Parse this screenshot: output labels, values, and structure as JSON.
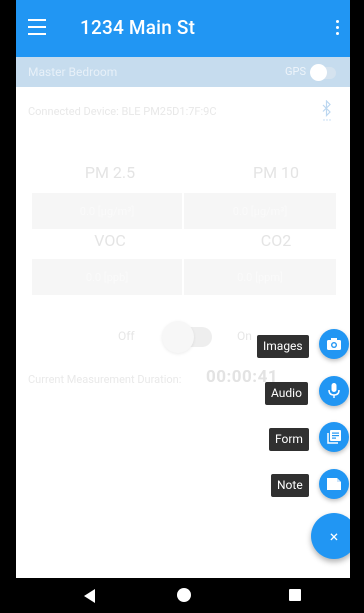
{
  "appbar": {
    "title": "1234 Main St"
  },
  "subbar": {
    "room": "Master Bedroom",
    "gps_label": "GPS"
  },
  "device": {
    "label": "Connected Device: BLE PM25D1:7F:9C"
  },
  "metrics": {
    "pm25": {
      "label": "PM 2.5",
      "value": "0.0 [µg/m³]"
    },
    "pm10": {
      "label": "PM 10",
      "value": "0.0 [µg/m³]"
    },
    "voc": {
      "label": "VOC",
      "value": "0.0 [ppb]"
    },
    "co2": {
      "label": "CO2",
      "value": "0.0 [ppm]"
    }
  },
  "toggle": {
    "off_label": "Off",
    "on_label": "On"
  },
  "duration": {
    "label": "Current Measurement Duration:",
    "value": "00:00:41"
  },
  "fab_menu": {
    "images_label": "Images",
    "audio_label": "Audio",
    "form_label": "Form",
    "note_label": "Note",
    "close_glyph": "×"
  },
  "colors": {
    "primary": "#2196f3",
    "label_bg": "#303030"
  }
}
